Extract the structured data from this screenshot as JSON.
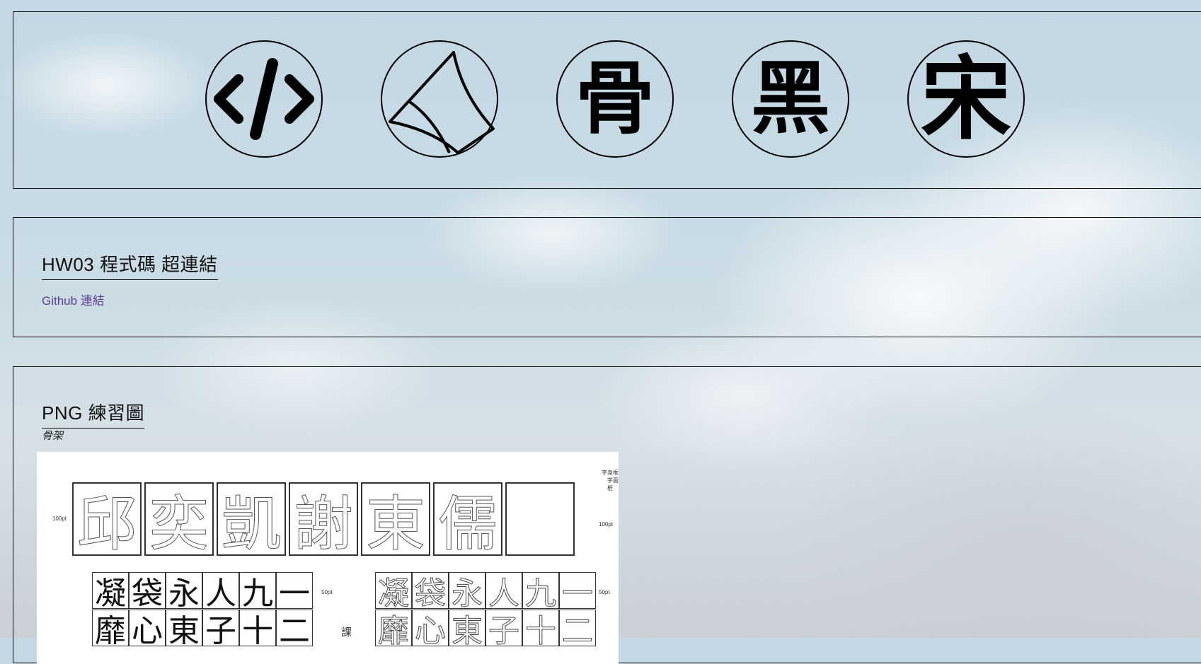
{
  "icons": [
    {
      "name": "code-icon"
    },
    {
      "name": "skeleton-icon"
    },
    {
      "name": "char-gu",
      "glyph": "骨"
    },
    {
      "name": "char-hei",
      "glyph": "黑"
    },
    {
      "name": "char-song",
      "glyph": "宋"
    }
  ],
  "hw03": {
    "title": "HW03 程式碼 超連結",
    "link_label": "Github 連結"
  },
  "png": {
    "title": "PNG 練習圖",
    "subtitle": "骨架",
    "sheet": {
      "big_chars": [
        "邱",
        "奕",
        "凱",
        "謝",
        "東",
        "儒",
        ""
      ],
      "practice_row1": [
        "凝",
        "袋",
        "永",
        "人",
        "九",
        "一"
      ],
      "practice_row2": [
        "靡",
        "心",
        "東",
        "子",
        "十",
        "二"
      ],
      "label_100pt": "100pt",
      "label_50pt": "50pt",
      "label_class": "課",
      "label_char_box": "字身框",
      "label_char_face": "字面框"
    }
  }
}
